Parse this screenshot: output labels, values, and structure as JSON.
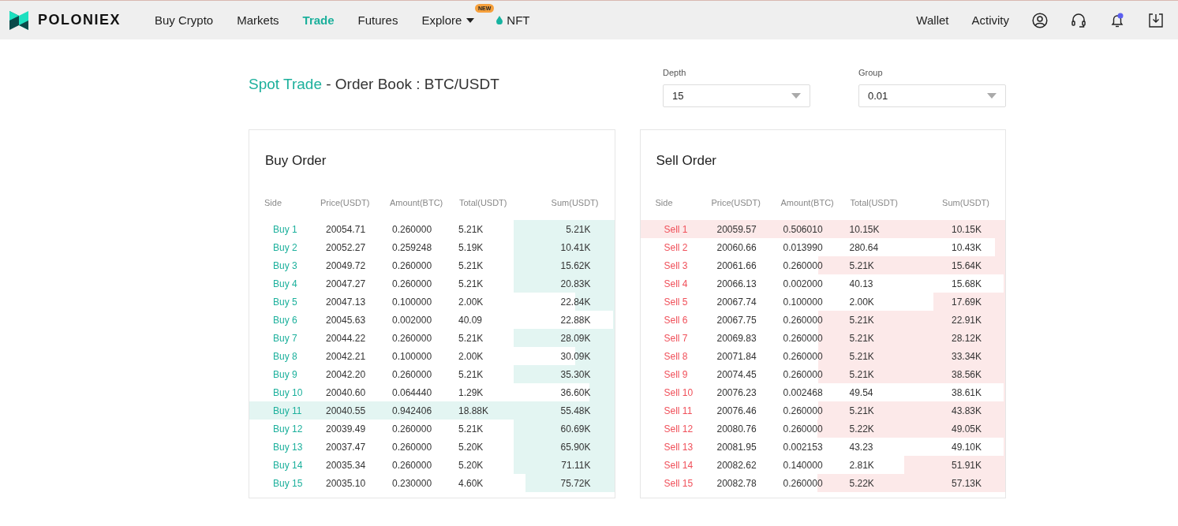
{
  "header": {
    "logo": "POLONIEX",
    "nav": [
      {
        "label": "Buy Crypto",
        "kind": "link",
        "selected": false
      },
      {
        "label": "Markets",
        "kind": "link",
        "selected": false
      },
      {
        "label": "Trade",
        "kind": "link",
        "selected": true
      },
      {
        "label": "Futures",
        "kind": "link",
        "selected": false
      },
      {
        "label": "Explore",
        "kind": "dropdown",
        "selected": false,
        "badge": "NEW"
      },
      {
        "label": "NFT",
        "kind": "drop",
        "selected": false
      }
    ],
    "links": [
      "Wallet",
      "Activity"
    ],
    "notification_dot": true
  },
  "title": {
    "link": "Spot Trade",
    "text": "- Order Book : BTC/USDT"
  },
  "selects": [
    {
      "label": "Depth",
      "value": "15"
    },
    {
      "label": "Group",
      "value": "0.01"
    }
  ],
  "books": [
    {
      "title": "Buy Order",
      "kind": "buy",
      "columns": [
        "Side",
        "Price(USDT)",
        "Amount(BTC)",
        "Total(USDT)",
        "Sum(USDT)"
      ],
      "rows": [
        {
          "side": "Buy 1",
          "price": "20054.71",
          "amount": "0.260000",
          "total": "5.21K",
          "sum": "5.21K",
          "level": 0.276
        },
        {
          "side": "Buy 2",
          "price": "20052.27",
          "amount": "0.259248",
          "total": "5.19K",
          "sum": "10.41K",
          "level": 0.275
        },
        {
          "side": "Buy 3",
          "price": "20049.72",
          "amount": "0.260000",
          "total": "5.21K",
          "sum": "15.62K",
          "level": 0.276
        },
        {
          "side": "Buy 4",
          "price": "20047.27",
          "amount": "0.260000",
          "total": "5.21K",
          "sum": "20.83K",
          "level": 0.276
        },
        {
          "side": "Buy 5",
          "price": "20047.13",
          "amount": "0.100000",
          "total": "2.00K",
          "sum": "22.84K",
          "level": 0.106
        },
        {
          "side": "Buy 6",
          "price": "20045.63",
          "amount": "0.002000",
          "total": "40.09",
          "sum": "22.88K",
          "level": 0.004
        },
        {
          "side": "Buy 7",
          "price": "20044.22",
          "amount": "0.260000",
          "total": "5.21K",
          "sum": "28.09K",
          "level": 0.276
        },
        {
          "side": "Buy 8",
          "price": "20042.21",
          "amount": "0.100000",
          "total": "2.00K",
          "sum": "30.09K",
          "level": 0.106
        },
        {
          "side": "Buy 9",
          "price": "20042.20",
          "amount": "0.260000",
          "total": "5.21K",
          "sum": "35.30K",
          "level": 0.276
        },
        {
          "side": "Buy 10",
          "price": "20040.60",
          "amount": "0.064440",
          "total": "1.29K",
          "sum": "36.60K",
          "level": 0.068
        },
        {
          "side": "Buy 11",
          "price": "20040.55",
          "amount": "0.942406",
          "total": "18.88K",
          "sum": "55.48K",
          "level": 1
        },
        {
          "side": "Buy 12",
          "price": "20039.49",
          "amount": "0.260000",
          "total": "5.21K",
          "sum": "60.69K",
          "level": 0.276
        },
        {
          "side": "Buy 13",
          "price": "20037.47",
          "amount": "0.260000",
          "total": "5.20K",
          "sum": "65.90K",
          "level": 0.275
        },
        {
          "side": "Buy 14",
          "price": "20035.34",
          "amount": "0.260000",
          "total": "5.20K",
          "sum": "71.11K",
          "level": 0.275
        },
        {
          "side": "Buy 15",
          "price": "20035.10",
          "amount": "0.230000",
          "total": "4.60K",
          "sum": "75.72K",
          "level": 0.244
        }
      ]
    },
    {
      "title": "Sell Order",
      "kind": "sell",
      "columns": [
        "Side",
        "Price(USDT)",
        "Amount(BTC)",
        "Total(USDT)",
        "Sum(USDT)"
      ],
      "rows": [
        {
          "side": "Sell 1",
          "price": "20059.57",
          "amount": "0.506010",
          "total": "10.15K",
          "sum": "10.15K",
          "level": 1
        },
        {
          "side": "Sell 2",
          "price": "20060.66",
          "amount": "0.013990",
          "total": "280.64",
          "sum": "10.43K",
          "level": 0.028
        },
        {
          "side": "Sell 3",
          "price": "20061.66",
          "amount": "0.260000",
          "total": "5.21K",
          "sum": "15.64K",
          "level": 0.513
        },
        {
          "side": "Sell 4",
          "price": "20066.13",
          "amount": "0.002000",
          "total": "40.13",
          "sum": "15.68K",
          "level": 0.004
        },
        {
          "side": "Sell 5",
          "price": "20067.74",
          "amount": "0.100000",
          "total": "2.00K",
          "sum": "17.69K",
          "level": 0.197
        },
        {
          "side": "Sell 6",
          "price": "20067.75",
          "amount": "0.260000",
          "total": "5.21K",
          "sum": "22.91K",
          "level": 0.513
        },
        {
          "side": "Sell 7",
          "price": "20069.83",
          "amount": "0.260000",
          "total": "5.21K",
          "sum": "28.12K",
          "level": 0.513
        },
        {
          "side": "Sell 8",
          "price": "20071.84",
          "amount": "0.260000",
          "total": "5.21K",
          "sum": "33.34K",
          "level": 0.513
        },
        {
          "side": "Sell 9",
          "price": "20074.45",
          "amount": "0.260000",
          "total": "5.21K",
          "sum": "38.56K",
          "level": 0.513
        },
        {
          "side": "Sell 10",
          "price": "20076.23",
          "amount": "0.002468",
          "total": "49.54",
          "sum": "38.61K",
          "level": 0.005
        },
        {
          "side": "Sell 11",
          "price": "20076.46",
          "amount": "0.260000",
          "total": "5.21K",
          "sum": "43.83K",
          "level": 0.513
        },
        {
          "side": "Sell 12",
          "price": "20080.76",
          "amount": "0.260000",
          "total": "5.22K",
          "sum": "49.05K",
          "level": 0.514
        },
        {
          "side": "Sell 13",
          "price": "20081.95",
          "amount": "0.002153",
          "total": "43.23",
          "sum": "49.10K",
          "level": 0.004
        },
        {
          "side": "Sell 14",
          "price": "20082.62",
          "amount": "0.140000",
          "total": "2.81K",
          "sum": "51.91K",
          "level": 0.277
        },
        {
          "side": "Sell 15",
          "price": "20082.78",
          "amount": "0.260000",
          "total": "5.22K",
          "sum": "57.13K",
          "level": 0.514
        }
      ]
    }
  ]
}
